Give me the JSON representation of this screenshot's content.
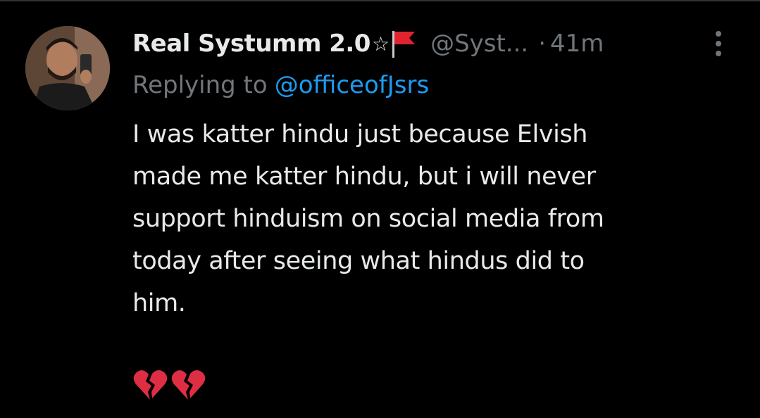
{
  "tweet": {
    "display_name": "Real Systumm 2.0",
    "name_badge_icon": "star-icon",
    "name_badge_glyph": "☆",
    "name_flag_icon": "red-flag-icon",
    "handle": "@Syst...",
    "separator": "·",
    "timestamp": "41m",
    "more_icon": "more-vertical-icon",
    "replying_to_label": "Replying to",
    "replying_to_handle": "@officeofJsrs",
    "body_lines": [
      "I was katter hindu just because Elvish",
      "made me katter hindu, but i will never",
      "support hinduism on social media from",
      "today after seeing what hindus did to",
      "him."
    ],
    "emojis": [
      "broken-heart-icon",
      "broken-heart-icon"
    ]
  },
  "colors": {
    "background": "#000000",
    "primary_text": "#e7e9ea",
    "secondary_text": "#71767b",
    "link": "#1d9bf0",
    "flag": "#e0242f",
    "heart": "#dd2e44"
  }
}
